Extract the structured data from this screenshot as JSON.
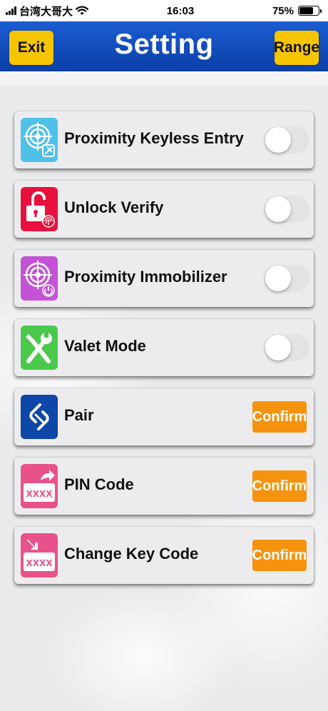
{
  "status_bar": {
    "carrier": "台湾大哥大",
    "time": "16:03",
    "battery_text": "75%",
    "battery_level": 0.75
  },
  "header": {
    "title": "Setting",
    "exit_label": "Exit",
    "range_label": "Range",
    "bg_color": "#0b3fa8",
    "button_color": "#f7c500"
  },
  "settings": [
    {
      "label": "Proximity Keyless Entry",
      "control": "toggle",
      "on": false,
      "icon": "proximity-target-key-icon",
      "icon_color": "#4fc1e9"
    },
    {
      "label": "Unlock Verify",
      "control": "toggle",
      "on": false,
      "icon": "unlock-fingerprint-icon",
      "icon_color": "#e8113e"
    },
    {
      "label": "Proximity Immobilizer",
      "control": "toggle",
      "on": false,
      "icon": "proximity-target-power-icon",
      "icon_color": "#c452d6"
    },
    {
      "label": "Valet Mode",
      "control": "toggle",
      "on": false,
      "icon": "wrench-screwdriver-icon",
      "icon_color": "#4cc94c"
    },
    {
      "label": "Pair",
      "control": "confirm",
      "button_label": "Confirm",
      "icon": "link-icon",
      "icon_color": "#0d47a8"
    },
    {
      "label": "PIN Code",
      "control": "confirm",
      "button_label": "Confirm",
      "icon": "pin-code-export-icon",
      "icon_color": "#e8528a",
      "icon_text": "XXXX"
    },
    {
      "label": "Change Key Code",
      "control": "confirm",
      "button_label": "Confirm",
      "icon": "key-code-import-icon",
      "icon_color": "#e8528a",
      "icon_text": "XXXX"
    }
  ],
  "colors": {
    "confirm": "#f6930e",
    "row_bg": "#ececee"
  }
}
